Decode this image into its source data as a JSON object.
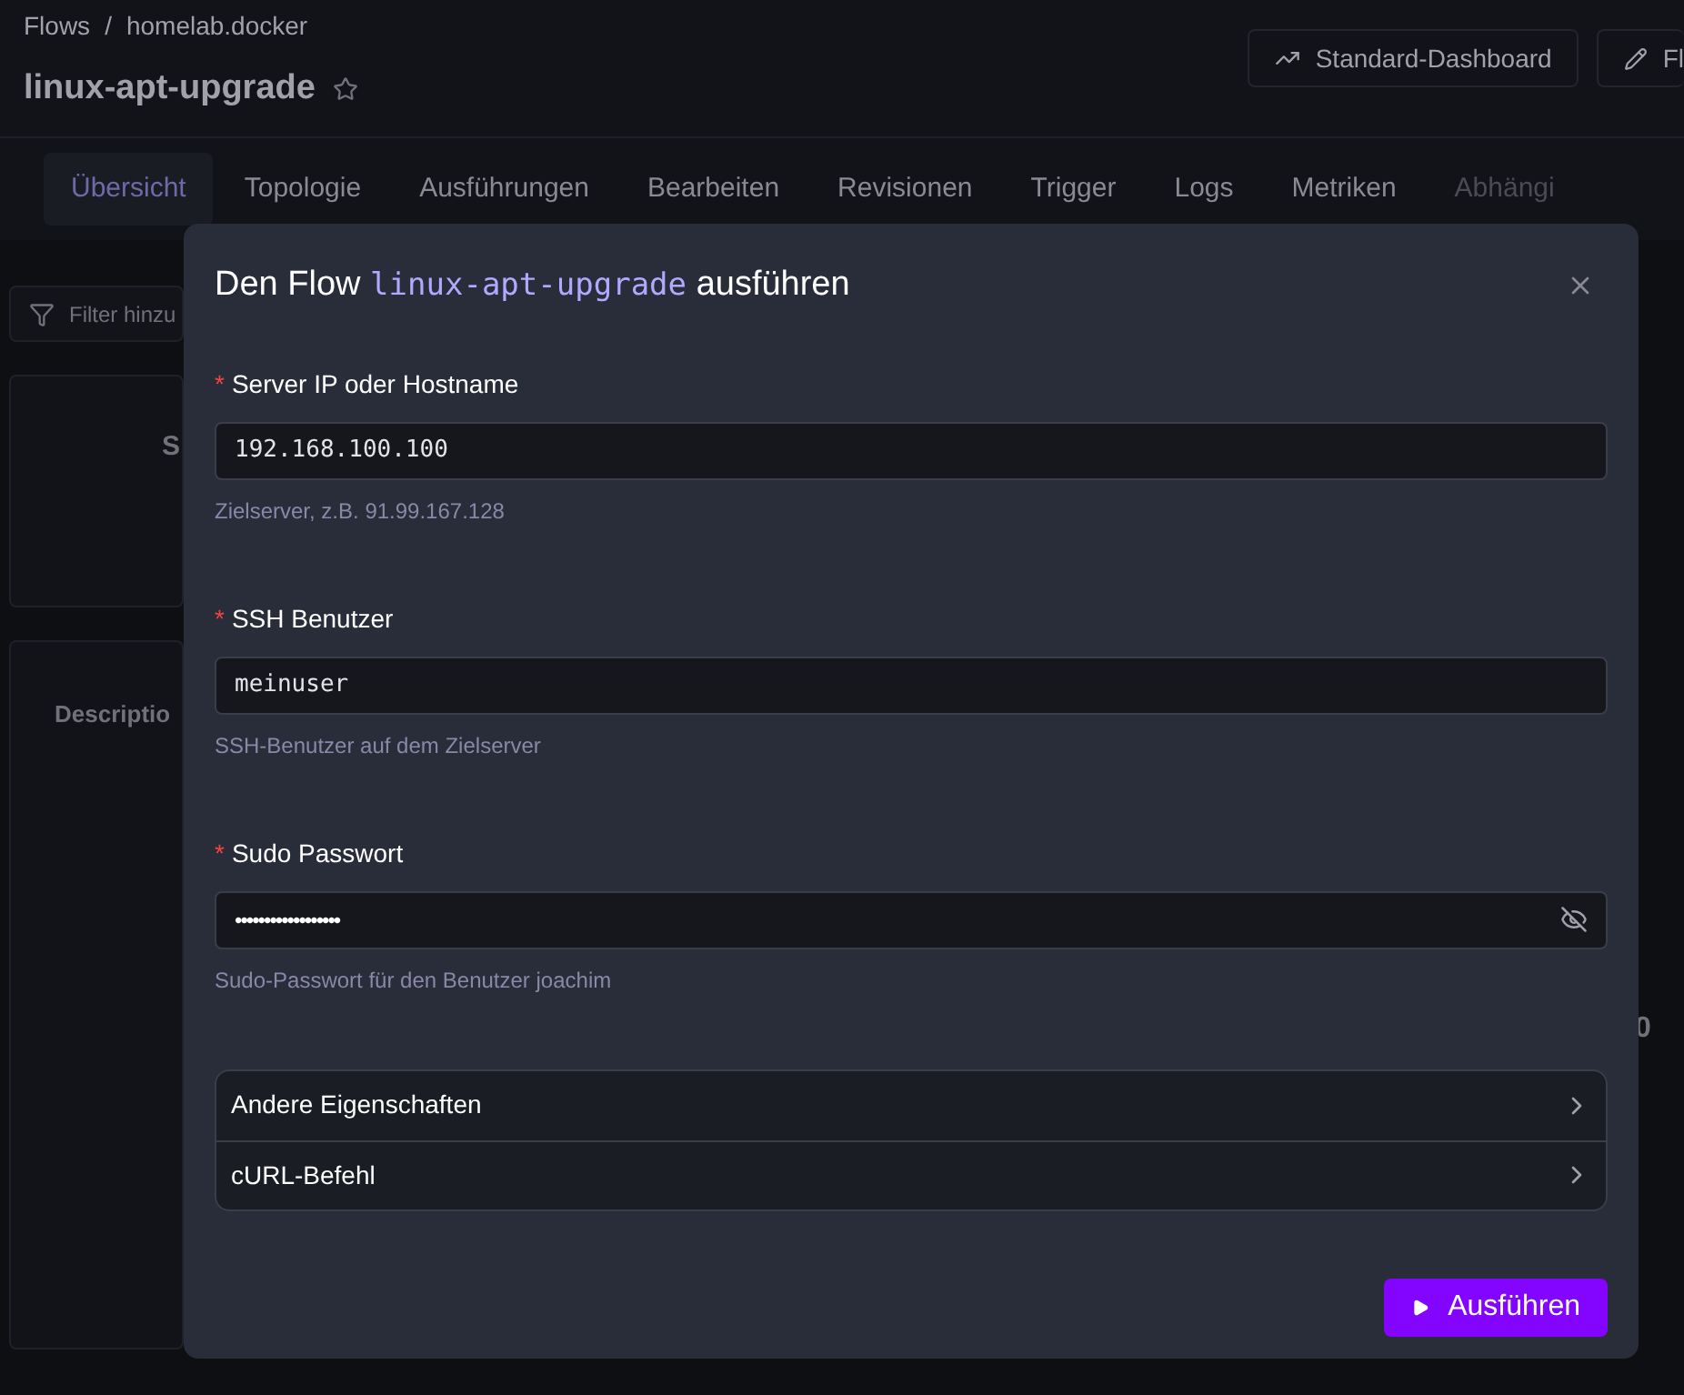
{
  "breadcrumb": [
    "Flows",
    "homelab.docker"
  ],
  "breadcrumb_separator": "/",
  "page_title": "linux-apt-upgrade",
  "header_buttons": [
    {
      "kind": "chart",
      "label": "Standard-Dashboard"
    },
    {
      "kind": "edit",
      "label": "Fl"
    }
  ],
  "tabs": [
    {
      "label": "Übersicht",
      "selected": true,
      "disabled": false
    },
    {
      "label": "Topologie",
      "selected": false,
      "disabled": false
    },
    {
      "label": "Ausführungen",
      "selected": false,
      "disabled": false
    },
    {
      "label": "Bearbeiten",
      "selected": false,
      "disabled": false
    },
    {
      "label": "Revisionen",
      "selected": false,
      "disabled": false
    },
    {
      "label": "Trigger",
      "selected": false,
      "disabled": false
    },
    {
      "label": "Logs",
      "selected": false,
      "disabled": false
    },
    {
      "label": "Metriken",
      "selected": false,
      "disabled": false
    },
    {
      "label": "Abhängi",
      "selected": false,
      "disabled": true
    }
  ],
  "filter": {
    "placeholder": "Filter hinzu"
  },
  "background_cards": [
    {
      "label": "S"
    },
    {
      "label": "Descriptio"
    }
  ],
  "background_value": "0",
  "dialog": {
    "title_before": "Den Flow",
    "flow_id": "linux-apt-upgrade",
    "title_after": "ausführen",
    "required_mark": "*",
    "fields": [
      {
        "kind": "text",
        "label": "Server IP oder Hostname",
        "required": true,
        "value": "192.168.100.100",
        "hint": "Zielserver, z.B. 91.99.167.128"
      },
      {
        "kind": "text",
        "label": "SSH Benutzer",
        "required": true,
        "value": "meinuser",
        "hint": "SSH-Benutzer auf dem Zielserver"
      },
      {
        "kind": "password",
        "label": "Sudo Passwort",
        "required": true,
        "value": "••••••••••••••••••",
        "hint": "Sudo-Passwort für den Benutzer joachim"
      }
    ],
    "sections": [
      {
        "label": "Andere Eigenschaften",
        "expanded": false
      },
      {
        "label": "cURL-Befehl",
        "expanded": false
      }
    ],
    "submit": "Ausführen"
  }
}
